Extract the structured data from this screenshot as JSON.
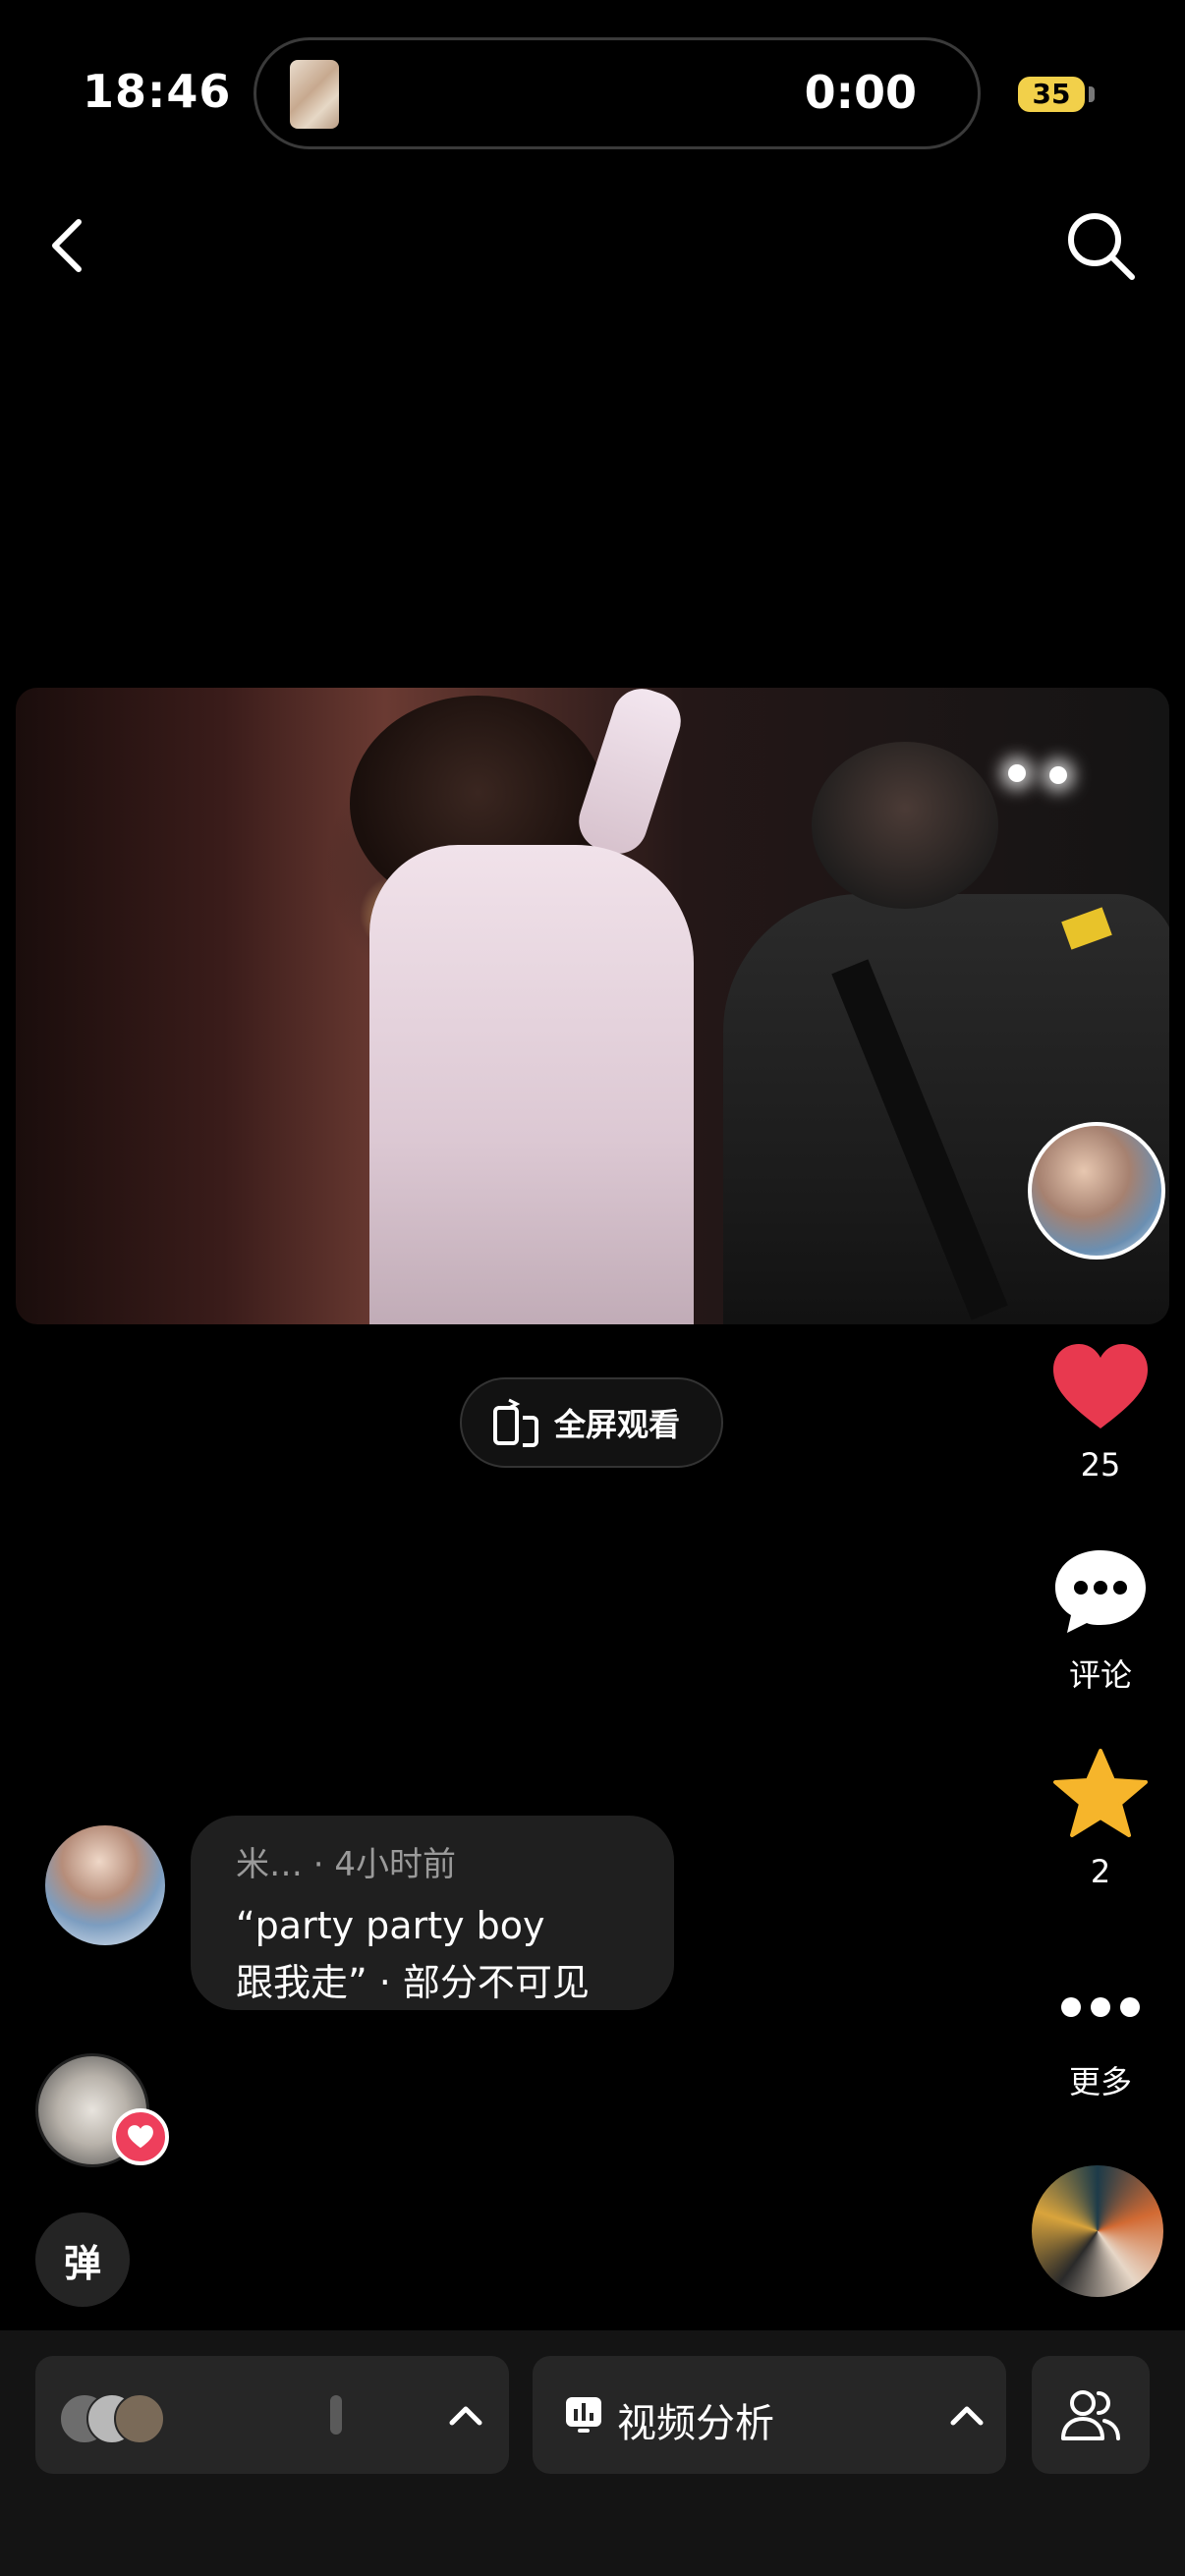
{
  "status_bar": {
    "time": "18:46",
    "now_playing_timer": "0:00",
    "battery": "35"
  },
  "video": {
    "fullscreen_label": "全屏观看"
  },
  "rail": {
    "like_count": "25",
    "like_color": "#e8394f",
    "comment_label": "评论",
    "favorite_count": "2",
    "favorite_color": "#f6b52b",
    "more_label": "更多"
  },
  "comment": {
    "meta": "米… · 4小时前",
    "text_line1": "“party party boy",
    "text_line2": "跟我走” · 部分不可见"
  },
  "danmu": {
    "label": "弹"
  },
  "bottom_bar": {
    "analysis_label": "视频分析"
  },
  "icons": [
    "back-icon",
    "search-icon",
    "fullscreen-rotate-icon",
    "heart-icon",
    "comment-icon",
    "star-icon",
    "more-icon",
    "chevron-up-icon",
    "bar-chart-icon",
    "people-icon"
  ]
}
